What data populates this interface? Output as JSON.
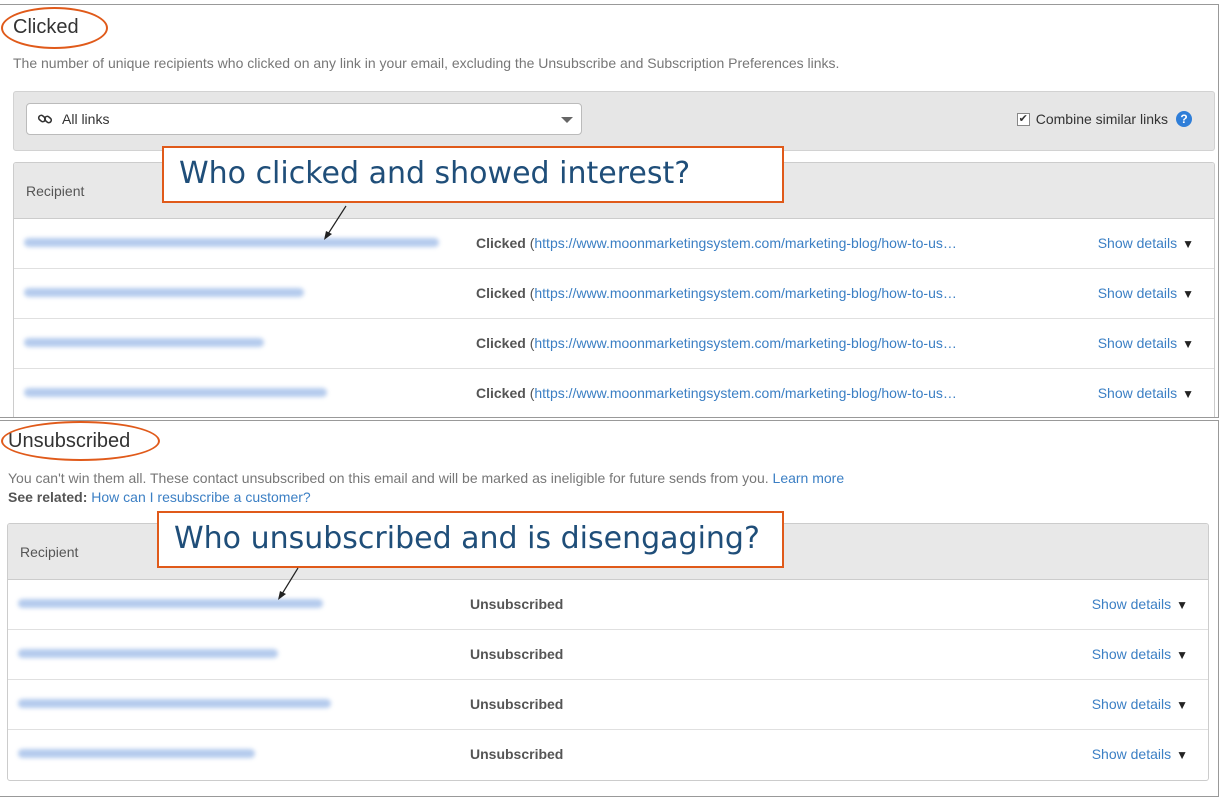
{
  "clicked": {
    "title": "Clicked",
    "description": "The number of unique recipients who clicked on any link in your email, excluding the Unsubscribe and Subscription Preferences links.",
    "filter": {
      "dropdown_label": "All links",
      "combine_label": "Combine similar links",
      "combine_checked": "✔",
      "help": "?"
    },
    "table_header": "Recipient",
    "callout": "Who clicked and showed interest?",
    "rows": [
      {
        "status": "Clicked",
        "open_paren": "(",
        "url": "https://www.moonmarketingsystem.com/marketing-blog/how-to-us…",
        "show": "Show details",
        "tri": "▼"
      },
      {
        "status": "Clicked",
        "open_paren": "(",
        "url": "https://www.moonmarketingsystem.com/marketing-blog/how-to-us…",
        "show": "Show details",
        "tri": "▼"
      },
      {
        "status": "Clicked",
        "open_paren": "(",
        "url": "https://www.moonmarketingsystem.com/marketing-blog/how-to-us…",
        "show": "Show details",
        "tri": "▼"
      },
      {
        "status": "Clicked",
        "open_paren": "(",
        "url": "https://www.moonmarketingsystem.com/marketing-blog/how-to-us…",
        "show": "Show details",
        "tri": "▼"
      }
    ]
  },
  "unsubscribed": {
    "title": "Unsubscribed",
    "description": "You can't win them all. These contact unsubscribed on this email and will be marked as ineligible for future sends from you.",
    "learn_more": "Learn more",
    "see_related_label": "See related:",
    "see_related_link": "How can I resubscribe a customer?",
    "table_header": "Recipient",
    "callout": "Who unsubscribed and is disengaging?",
    "rows": [
      {
        "status": "Unsubscribed",
        "show": "Show details",
        "tri": "▼"
      },
      {
        "status": "Unsubscribed",
        "show": "Show details",
        "tri": "▼"
      },
      {
        "status": "Unsubscribed",
        "show": "Show details",
        "tri": "▼"
      },
      {
        "status": "Unsubscribed",
        "show": "Show details",
        "tri": "▼"
      }
    ]
  },
  "colors": {
    "accent_orange": "#e05a1a",
    "link_blue": "#3b7fc4",
    "callout_text": "#1f4e79"
  },
  "icons": [
    "chain-link-icon",
    "caret-down-icon",
    "checkbox-icon",
    "help-icon",
    "triangle-down-icon",
    "arrow-icon"
  ]
}
